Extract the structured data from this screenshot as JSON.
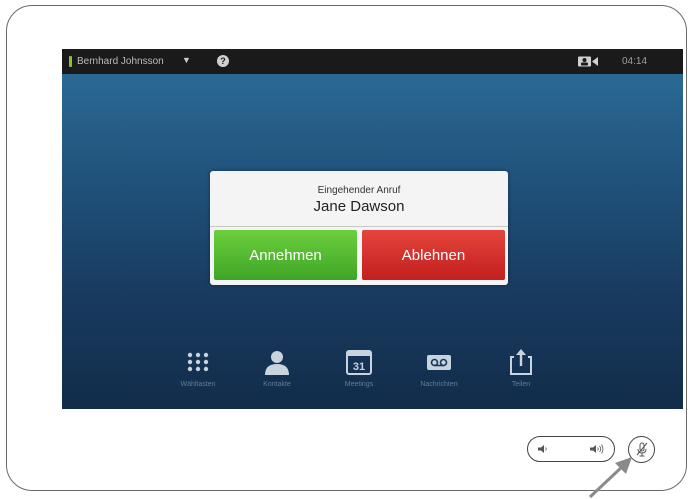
{
  "topbar": {
    "user_name": "Bernhard Johnsson",
    "caret": "▼",
    "help": "?",
    "clock": "04:14",
    "status_color": "#8bc23a"
  },
  "dialog": {
    "call_label": "Eingehender Anruf",
    "caller_name": "Jane Dawson",
    "accept_label": "Annehmen",
    "reject_label": "Ablehnen",
    "accept_color": "#4cb52d",
    "reject_color": "#d32f2a"
  },
  "dock": {
    "items": [
      {
        "label": "Wähltasten",
        "icon": "keypad-icon"
      },
      {
        "label": "Kontakte",
        "icon": "contacts-icon"
      },
      {
        "label": "Meetings",
        "icon": "calendar-icon",
        "icon_text": "31"
      },
      {
        "label": "Nachrichten",
        "icon": "voicemail-icon"
      },
      {
        "label": "Teilen",
        "icon": "share-icon"
      }
    ]
  },
  "hardware": {
    "volume_icons": [
      "volume-down-icon",
      "volume-up-icon"
    ],
    "mute_icon": "mic-mute-icon"
  }
}
